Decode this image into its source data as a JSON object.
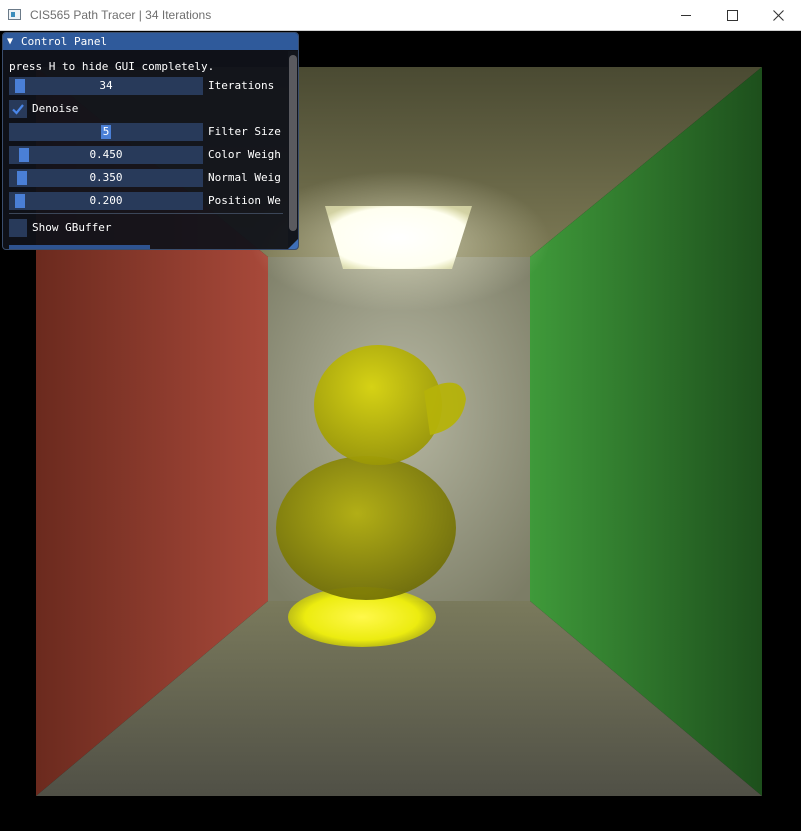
{
  "window": {
    "title": "CIS565 Path Tracer | 34 Iterations",
    "icons": [
      "app-icon",
      "minimize-icon",
      "maximize-icon",
      "close-icon"
    ]
  },
  "panel": {
    "title": "Control Panel",
    "hint": "press H to hide GUI completely.",
    "iterations": {
      "value": "34",
      "label": "Iterations",
      "level": 0.02
    },
    "denoise": {
      "label": "Denoise",
      "checked": true
    },
    "filter_size": {
      "value": "5",
      "label": "Filter Size",
      "level": 0.5
    },
    "color_weight": {
      "value": "0.450",
      "label": "Color Weigh",
      "level": 0.045
    },
    "normal_weight": {
      "value": "0.350",
      "label": "Normal Weig",
      "level": 0.035
    },
    "position_weight": {
      "value": "0.200",
      "label": "Position We",
      "level": 0.02
    },
    "show_gbuffer": {
      "label": "Show GBuffer",
      "checked": false
    }
  },
  "colors": {
    "panel_header": "#2f5a9b",
    "slider_bg": "#283a5a",
    "slider_grab": "#4a7fd6",
    "left_wall": "#8c3a28",
    "right_wall": "#2f7a2a",
    "duck": "#b8b800"
  }
}
